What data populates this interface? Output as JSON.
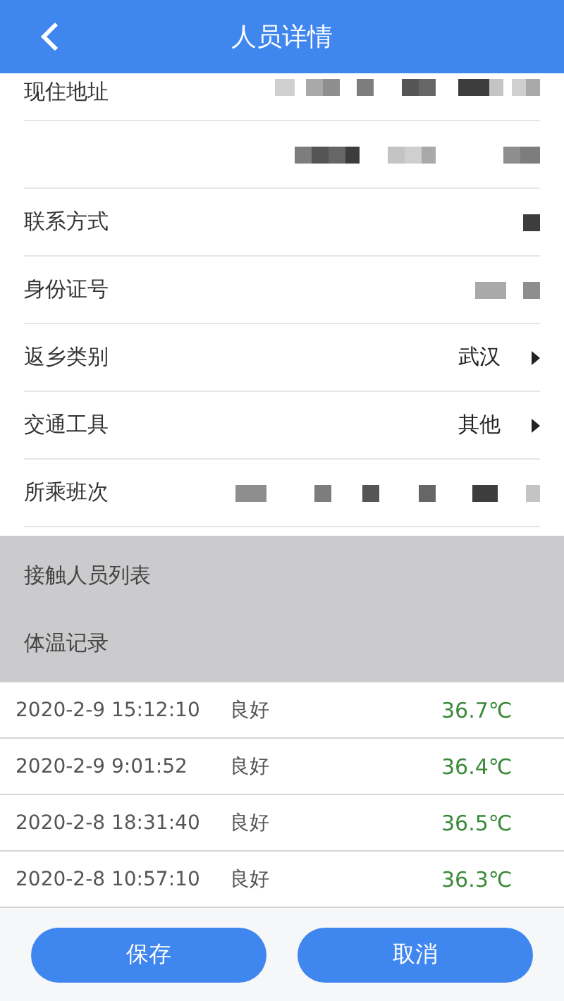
{
  "header": {
    "title": "人员详情"
  },
  "fields": [
    {
      "label": "现住地址",
      "kind": "redacted"
    },
    {
      "kind": "redacted"
    },
    {
      "label": "联系方式",
      "kind": "redacted"
    },
    {
      "label": "身份证号",
      "kind": "redacted"
    },
    {
      "label": "返乡类别",
      "kind": "select",
      "value": "武汉"
    },
    {
      "label": "交通工具",
      "kind": "select",
      "value": "其他"
    },
    {
      "label": "所乘班次",
      "kind": "redacted"
    }
  ],
  "sections": [
    "接触人员列表",
    "体温记录"
  ],
  "temperature_records": [
    {
      "time": "2020-2-9 15:12:10",
      "status": "良好",
      "temperature": "36.7℃"
    },
    {
      "time": "2020-2-9 9:01:52",
      "status": "良好",
      "temperature": "36.4℃"
    },
    {
      "time": "2020-2-8 18:31:40",
      "status": "良好",
      "temperature": "36.5℃"
    },
    {
      "time": "2020-2-8 10:57:10",
      "status": "良好",
      "temperature": "36.3℃"
    }
  ],
  "buttons": [
    "保存",
    "取消"
  ]
}
